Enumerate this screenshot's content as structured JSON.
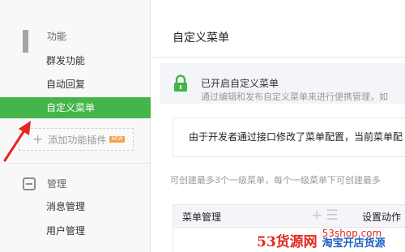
{
  "sidebar": {
    "sections": [
      {
        "title": "功能",
        "icon": "grid-icon",
        "items": [
          "群发功能",
          "自动回复",
          "自定义菜单"
        ]
      },
      {
        "title": "管理",
        "icon": "inbox-icon",
        "items": [
          "消息管理",
          "用户管理"
        ]
      }
    ],
    "active_item": "自定义菜单",
    "add_plugin_label": "添加功能插件",
    "add_plugin_badge": "NEW"
  },
  "main": {
    "title": "自定义菜单",
    "notice": {
      "icon": "lock-icon",
      "title": "已开启自定义菜单",
      "desc": "通过编辑和发布自定义菜单来进行便携管理，如"
    },
    "alert": "由于开发者通过接口修改了菜单配置，当前菜单配",
    "hint": "可创建最多3个一级菜单，每个一级菜单下可创建最多",
    "table": {
      "header_label": "菜单管理",
      "header_icons": [
        "plus-icon",
        "sort-icon"
      ],
      "action_label": "设置动作"
    }
  },
  "watermark": {
    "logo": "53货源网",
    "site": "53shop.com",
    "slogan": "淘宝开店货源"
  },
  "colors": {
    "accent": "#44b549",
    "annotation_arrow": "#e3281f",
    "sidebar_bg": "#f8f8f8",
    "notice_bg": "#f4f5f9"
  }
}
